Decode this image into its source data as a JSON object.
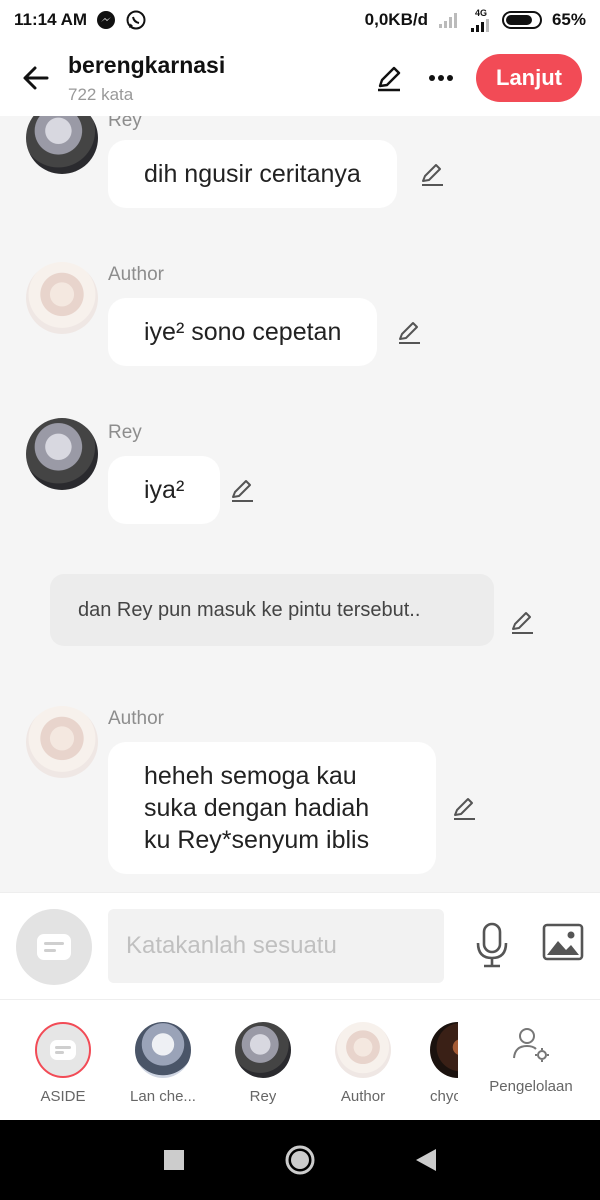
{
  "status_bar": {
    "time": "11:14 AM",
    "network_speed": "0,0KB/d",
    "network_type": "4G",
    "battery": "65%",
    "icons": [
      "messenger-icon",
      "whatsapp-icon",
      "signal-icon",
      "battery-icon"
    ]
  },
  "header": {
    "title": "berengkarnasi",
    "subtitle": "722 kata",
    "next_label": "Lanjut",
    "accent_color": "#f24b56"
  },
  "messages": [
    {
      "speaker": "Rey",
      "text": "dih ngusir ceritanya"
    },
    {
      "speaker": "Author",
      "text": "iye² sono cepetan"
    },
    {
      "speaker": "Rey",
      "text": "iya²"
    },
    {
      "speaker": "",
      "text": "dan Rey pun masuk ke pintu tersebut.."
    },
    {
      "speaker": "Author",
      "text": "heheh semoga kau suka dengan hadiah ku Rey*senyum iblis"
    }
  ],
  "input": {
    "placeholder": "Katakanlah sesuatu"
  },
  "characters": [
    {
      "name": "ASIDE"
    },
    {
      "name": "Lan che..."
    },
    {
      "name": "Rey"
    },
    {
      "name": "Author"
    },
    {
      "name": "chyo"
    }
  ],
  "manage_label": "Pengelolaan"
}
